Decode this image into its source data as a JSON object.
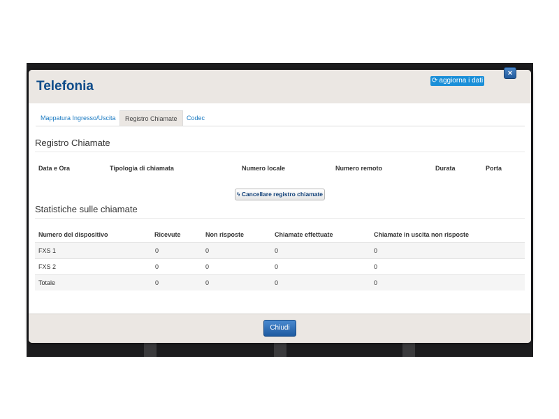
{
  "modal": {
    "title": "Telefonia",
    "refresh_label": "aggiorna i dati",
    "refresh_icon": "refresh-icon",
    "close_glyph": "×",
    "close_icon": "close-icon"
  },
  "tabs": [
    {
      "label": "Mappatura Ingresso/Uscita",
      "active": false
    },
    {
      "label": "Registro Chiamate",
      "active": true
    },
    {
      "label": "Codec",
      "active": false
    }
  ],
  "call_log": {
    "title": "Registro Chiamate",
    "columns": [
      "Data e Ora",
      "Tipologia di chiamata",
      "Numero locale",
      "Numero remoto",
      "Durata",
      "Porta"
    ],
    "clear_button_label": "Cancellare registro chiamate",
    "clear_button_icon": "lightning-icon"
  },
  "stats": {
    "title": "Statistiche sulle chiamate",
    "columns": [
      "Numero del dispositivo",
      "Ricevute",
      "Non risposte",
      "Chiamate effettuate",
      "Chiamate in uscita non risposte"
    ],
    "rows": [
      [
        "FXS 1",
        "0",
        "0",
        "0",
        "0"
      ],
      [
        "FXS 2",
        "0",
        "0",
        "0",
        "0"
      ],
      [
        "Totale",
        "0",
        "0",
        "0",
        "0"
      ]
    ]
  },
  "footer": {
    "close_label": "Chiudi"
  },
  "colors": {
    "accent": "#0f4c8a",
    "link": "#1a7ac2",
    "header_bg": "#ebe7e3",
    "refresh_bg": "#1a8fd8"
  }
}
